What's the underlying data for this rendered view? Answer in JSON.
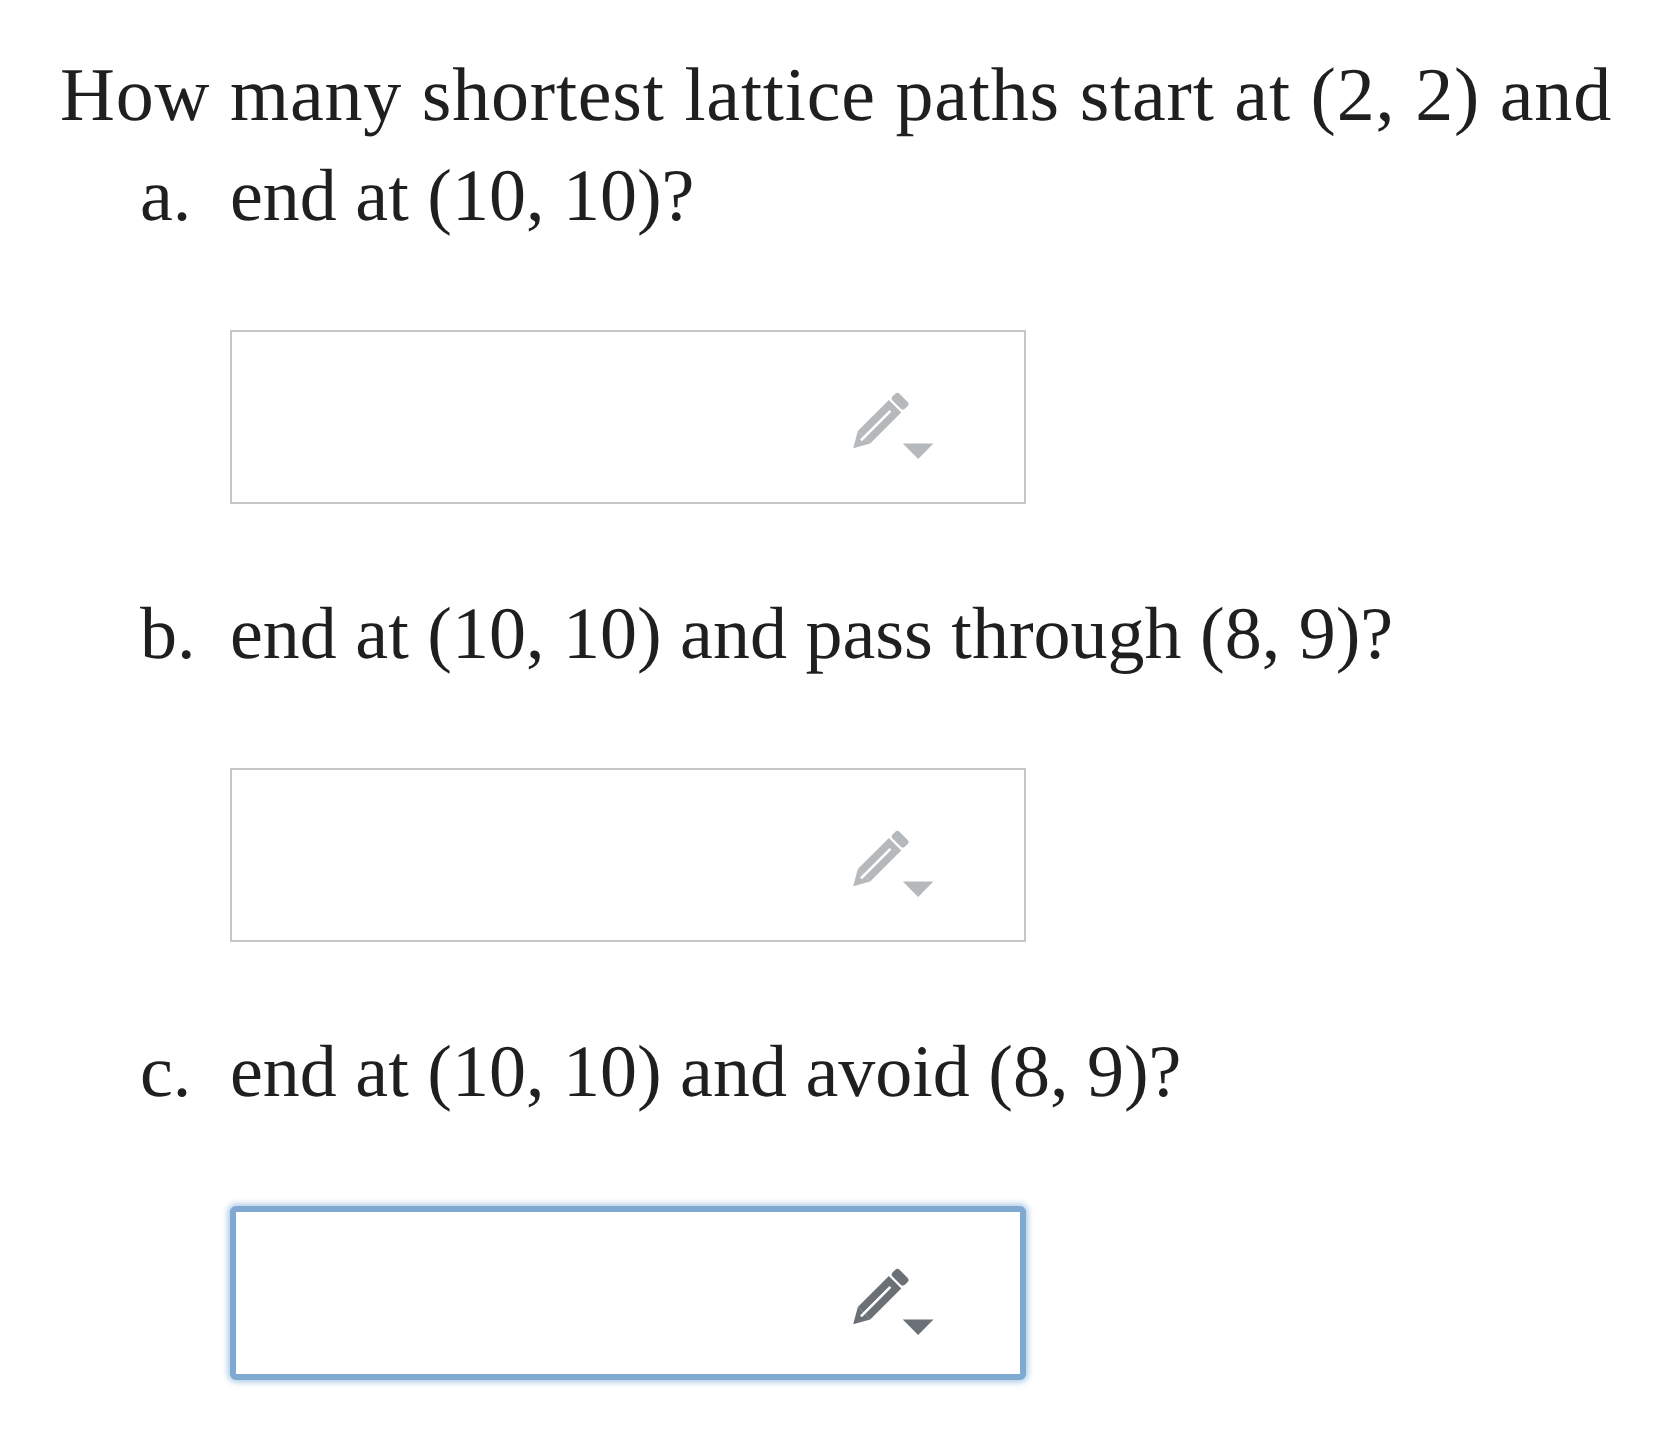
{
  "question": {
    "text": "How many shortest lattice paths start at (2, 2) and"
  },
  "parts": [
    {
      "label": "a.",
      "text": "end at (10, 10)?",
      "answer": {
        "focused": false
      }
    },
    {
      "label": "b.",
      "text": "end at (10, 10) and pass through (8, 9)?",
      "answer": {
        "focused": false
      }
    },
    {
      "label": "c.",
      "text": "end at (10, 10) and avoid (8, 9)?",
      "answer": {
        "focused": true
      }
    }
  ]
}
